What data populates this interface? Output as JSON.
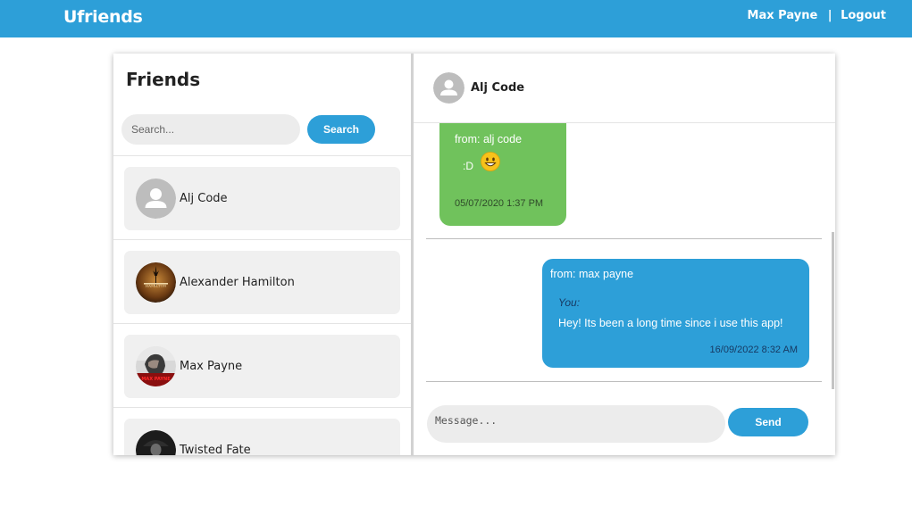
{
  "navbar": {
    "brand": "Ufriends",
    "user_name": "Max Payne",
    "separator": "|",
    "logout_label": "Logout",
    "color": "#2d9fd8"
  },
  "friends": {
    "title": "Friends",
    "search_placeholder": "Search...",
    "search_button": "Search",
    "items": [
      {
        "name": "Alj Code",
        "avatar": "default-user-avatar"
      },
      {
        "name": "Alexander Hamilton",
        "avatar": "hamilton-avatar"
      },
      {
        "name": "Max Payne",
        "avatar": "max-payne-avatar"
      },
      {
        "name": "Twisted Fate",
        "avatar": "twisted-fate-avatar"
      }
    ]
  },
  "chat": {
    "contact_name": "Alj Code",
    "contact_avatar": "default-user-avatar",
    "messages": [
      {
        "direction": "incoming",
        "from": "from: alj code",
        "text": ":D",
        "emoji": "smiley-emoji",
        "time": "05/07/2020 1:37 PM",
        "color": "#70c25c"
      },
      {
        "direction": "outgoing",
        "from": "from: max payne",
        "you_label": "You:",
        "text": "Hey! Its been a long time since i use this app!",
        "time": "16/09/2022 8:32 AM",
        "color": "#2d9fd8"
      }
    ],
    "input_placeholder": "Message...",
    "send_button": "Send"
  }
}
